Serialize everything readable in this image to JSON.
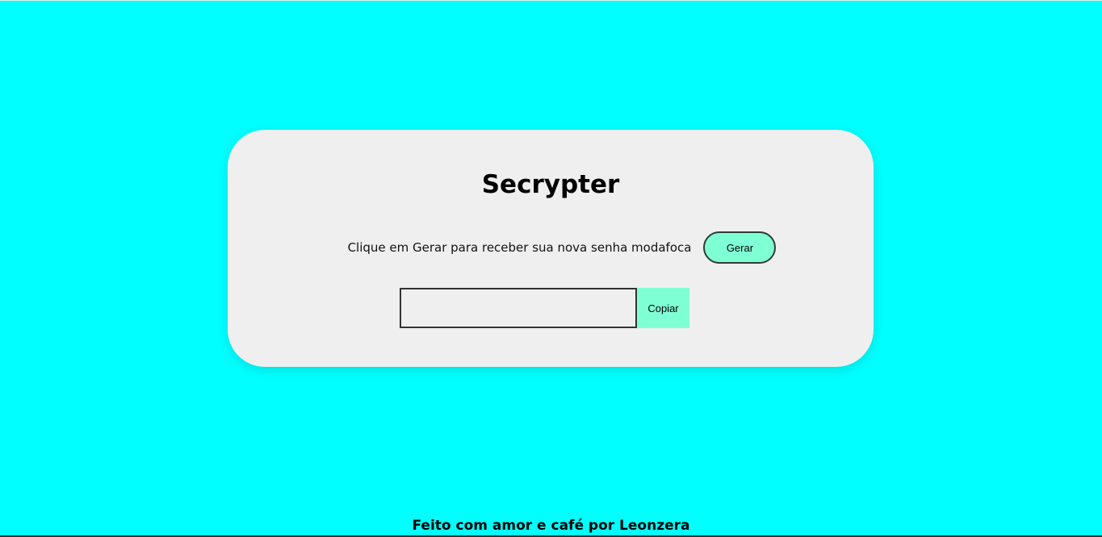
{
  "app": {
    "title": "Secrypter"
  },
  "generator": {
    "prompt": "Clique em Gerar para receber sua nova senha modafoca",
    "generate_label": "Gerar"
  },
  "output": {
    "password_value": "",
    "copy_label": "Copiar"
  },
  "footer": {
    "text": "Feito com amor e café por Leonzera"
  },
  "colors": {
    "page_background": "#00ffff",
    "card_background": "#efefef",
    "button_accent": "#7fffd4"
  }
}
